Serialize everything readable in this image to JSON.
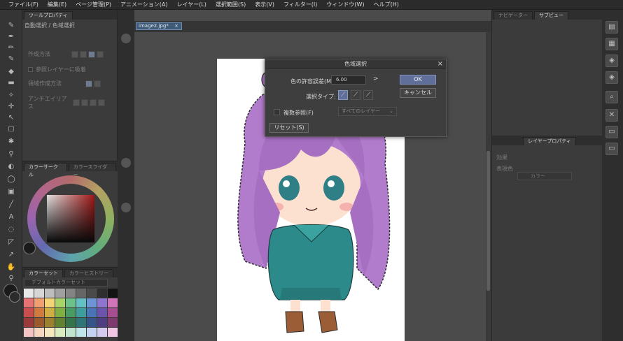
{
  "menu": [
    "ファイル(F)",
    "編集(E)",
    "ページ管理(P)",
    "アニメーション(A)",
    "レイヤー(L)",
    "選択範囲(S)",
    "表示(V)",
    "フィルター(I)",
    "ウィンドウ(W)",
    "ヘルプ(H)"
  ],
  "tool_panel": {
    "tab": "ツールプロパティ",
    "title": "自動選択 / 色域選択",
    "rows": [
      "作成方法",
      "参照レイヤーに吸着",
      "領域作成方法",
      "アンチエイリアス"
    ]
  },
  "color_panel": {
    "tab_active": "カラーサークル",
    "tab_other": "カラースライダー"
  },
  "color_set": {
    "tab_active": "カラーセット",
    "tab_other": "カラーヒストリー",
    "set_name": "デフォルトカラーセット"
  },
  "document": {
    "tab": "image2.jpg*",
    "close": "×"
  },
  "right_panel": {
    "top_tabs": [
      "ナビゲーター",
      "サブビュー"
    ],
    "layer_tab": "レイヤープロパティ",
    "effect_label": "効果",
    "expression_label": "表現色",
    "expression_value": "カラー"
  },
  "dialog": {
    "title": "色域選択",
    "close": "×",
    "tolerance_label": "色の許容誤差(M):",
    "tolerance_value": "6.00",
    "tolerance_arrow": ">",
    "type_label": "選択タイプ:",
    "multi_ref_label": "複数参照(F)",
    "all_layers": "すべてのレイヤー",
    "reset": "リセット(S)",
    "ok": "OK",
    "cancel": "キャンセル"
  },
  "colors": {
    "accent": "#5f6f9a",
    "doc_tab": "#3f5b78"
  },
  "swatches": [
    "#e8e8e8",
    "#d6d6d6",
    "#bdbdbd",
    "#a0a0a0",
    "#848484",
    "#666",
    "#4a4a4a",
    "#2e2e2e",
    "#141414",
    "#e57373",
    "#f0a070",
    "#f2d479",
    "#a8d46a",
    "#6cc08a",
    "#63c0c4",
    "#6d95d6",
    "#8f75cf",
    "#cf75b8",
    "#c94f4f",
    "#d07a3f",
    "#cfae46",
    "#7fae43",
    "#4a9a64",
    "#3f9da0",
    "#4a74b3",
    "#6a54ad",
    "#a74e93",
    "#9a3a3a",
    "#9a5a2e",
    "#9a8132",
    "#5e8231",
    "#36734a",
    "#2f7477",
    "#365586",
    "#4e3e81",
    "#7c3a6d",
    "#f3c4c4",
    "#f5d6bf",
    "#f5e8bf",
    "#d9ecc0",
    "#c0e4cc",
    "#bfe6e8",
    "#c4d4f0",
    "#d5cbef",
    "#efc9e3"
  ]
}
